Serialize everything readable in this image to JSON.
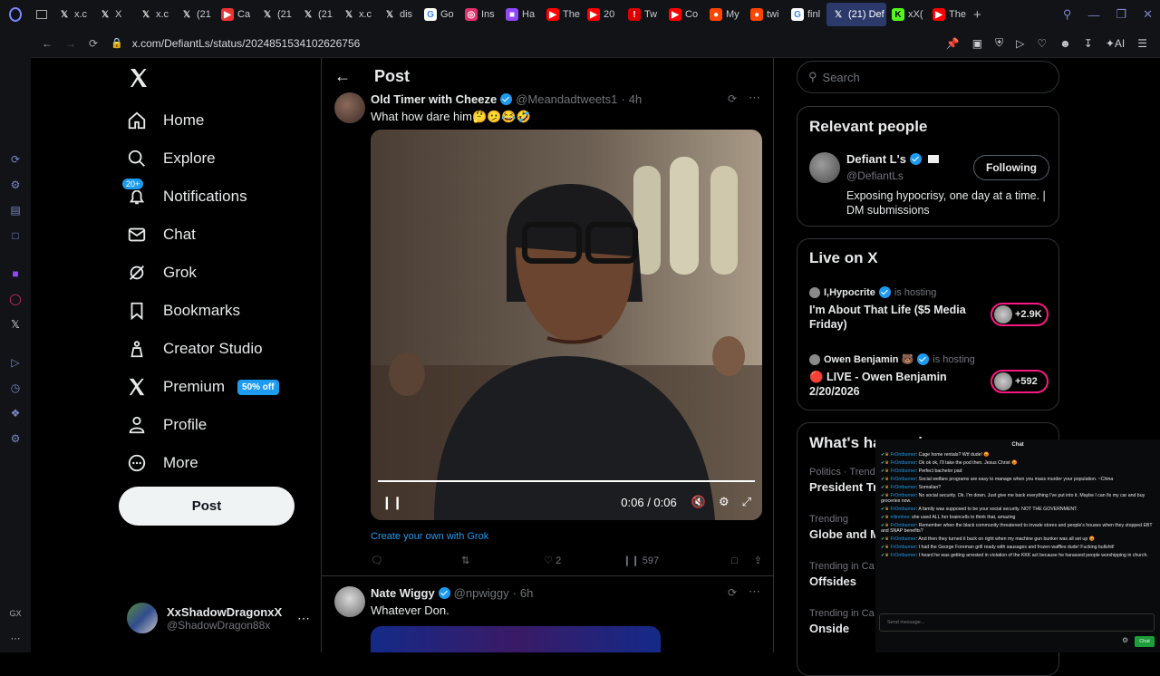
{
  "browser": {
    "tabs": [
      {
        "icon": "x-logo-icon",
        "label": "x.c"
      },
      {
        "icon": "x-logo-icon",
        "label": "X"
      },
      {
        "icon": "x-logo-icon",
        "label": "x.c"
      },
      {
        "icon": "x-logo-icon",
        "label": "(21"
      },
      {
        "icon": "play-icon",
        "label": "Ca"
      },
      {
        "icon": "x-logo-icon",
        "label": "(21"
      },
      {
        "icon": "x-logo-icon",
        "label": "(21"
      },
      {
        "icon": "x-logo-icon",
        "label": "x.c"
      },
      {
        "icon": "x-logo-icon",
        "label": "dis"
      },
      {
        "icon": "google-icon",
        "label": "Go"
      },
      {
        "icon": "instagram-icon",
        "label": "Ins"
      },
      {
        "icon": "twitch-icon",
        "label": "Ha"
      },
      {
        "icon": "youtube-icon",
        "label": "The"
      },
      {
        "icon": "youtube-icon",
        "label": "20"
      },
      {
        "icon": "alert-icon",
        "label": "Tw"
      },
      {
        "icon": "youtube-icon",
        "label": "Co"
      },
      {
        "icon": "reddit-icon",
        "label": "My"
      },
      {
        "icon": "reddit-icon",
        "label": "twi"
      },
      {
        "icon": "google-icon",
        "label": "finl"
      },
      {
        "icon": "x-logo-icon",
        "label": "(21) Def"
      },
      {
        "icon": "kick-icon",
        "label": "xX("
      },
      {
        "icon": "youtube-icon",
        "label": "The"
      }
    ],
    "active_tab": 19,
    "url": "x.com/DefiantLs/status/2024851534102626756",
    "ai_label": "AI"
  },
  "nav": {
    "items": [
      {
        "icon": "home-icon",
        "label": "Home"
      },
      {
        "icon": "search-icon",
        "label": "Explore"
      },
      {
        "icon": "bell-icon",
        "label": "Notifications",
        "badge": "20+"
      },
      {
        "icon": "mail-icon",
        "label": "Chat"
      },
      {
        "icon": "grok-icon",
        "label": "Grok"
      },
      {
        "icon": "bookmark-icon",
        "label": "Bookmarks"
      },
      {
        "icon": "creator-studio-icon",
        "label": "Creator Studio"
      },
      {
        "icon": "x-logo-icon",
        "label": "Premium",
        "badge": "50% off"
      },
      {
        "icon": "person-icon",
        "label": "Profile"
      },
      {
        "icon": "more-circle-icon",
        "label": "More"
      }
    ],
    "post_label": "Post",
    "account": {
      "name": "XxShadowDragonxX",
      "handle": "@ShadowDragon88x"
    }
  },
  "main": {
    "title": "Post",
    "tweet1": {
      "name": "Old Timer with Cheeze",
      "handle": "@Meandadtweets1",
      "time": "4h",
      "text": "What how dare him🤔🫤😂🤣",
      "video_time": "0:06 / 0:06",
      "grok_link": "Create your own with Grok",
      "likes": "2",
      "views": "597"
    },
    "tweet2": {
      "name": "Nate Wiggy",
      "handle": "@npwiggy",
      "time": "6h",
      "text": "Whatever Don."
    }
  },
  "right": {
    "search_placeholder": "Search",
    "relevant": {
      "title": "Relevant people",
      "name": "Defiant L's",
      "handle": "@DefiantLs",
      "bio": "Exposing hypocrisy, one day at a time. | DM submissions",
      "follow_label": "Following"
    },
    "live": {
      "title": "Live on X",
      "items": [
        {
          "host": "I,Hypocrite",
          "status": "is hosting",
          "title": "I'm About That Life ($5 Media Friday)",
          "count": "+2.9K"
        },
        {
          "host": "Owen Benjamin 🐻",
          "status": "is hosting",
          "title": "🔴 LIVE - Owen Benjamin 2/20/2026",
          "count": "+592"
        }
      ]
    },
    "happening": {
      "title": "What's happening",
      "items": [
        {
          "meta": "Politics · Trend",
          "title": "President Tr"
        },
        {
          "meta": "Trending",
          "title": "Globe and M"
        },
        {
          "meta": "Trending in Ca",
          "title": "Offsides"
        },
        {
          "meta": "Trending in Ca",
          "title": "Onside"
        }
      ]
    }
  },
  "chat": {
    "title": "Chat",
    "messages": [
      {
        "user": "FrOntburner",
        "text": "Cage home rentals? Wtf dude! 😡"
      },
      {
        "user": "FrOntburner",
        "text": "Ok ok ok, I'll take the pod then. Jesus Christ 😡"
      },
      {
        "user": "FrOntburner",
        "text": "Perfect bachelor pad"
      },
      {
        "user": "FrOntburner",
        "text": "Social welfare programs are easy to manage when you mass murder your population. ~China"
      },
      {
        "user": "FrOntburner",
        "text": "Somalian?"
      },
      {
        "user": "FrOntburner",
        "text": "No social security. Ok. I'm down. Just give me back everything I've put into it. Maybe I can fix my car and buy groceries now."
      },
      {
        "user": "FrOntburner",
        "text": "A family was supposed to be your social security. NOT THE GOVERNMENT."
      },
      {
        "user": "mlinmlee",
        "text": "she used ALL her braincells to think that, amazing"
      },
      {
        "user": "FrOntburner",
        "text": "Remember when the black community threatened to invade stores and people's houses when they stopped EBT and SNAP benefits?"
      },
      {
        "user": "FrOntburner",
        "text": "And then they turned it back on right when my machine gun bunker was all set up 😡"
      },
      {
        "user": "FrOntburner",
        "text": "I had the George Foreman grill ready with sausages and frozen waffles dude! Fucking bullshit!"
      },
      {
        "user": "FrOntburner",
        "text": "I heard he was getting arrested in violation of the KKK act because he harassed people worshipping in church."
      }
    ],
    "input_placeholder": "Send message...",
    "send_label": "Chat"
  },
  "colors": {
    "accent": "#1d9bf0",
    "live_pink": "#f91880"
  }
}
